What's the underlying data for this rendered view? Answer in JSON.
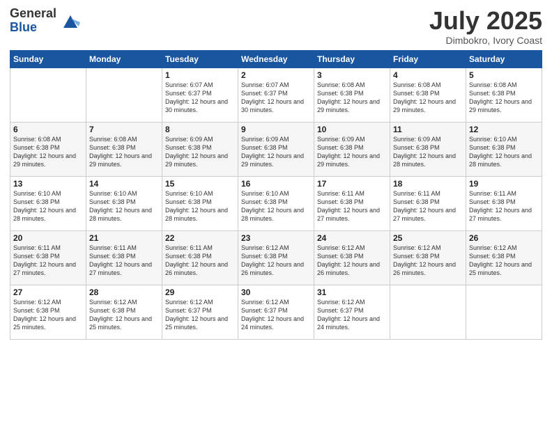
{
  "logo": {
    "general": "General",
    "blue": "Blue"
  },
  "header": {
    "month": "July 2025",
    "location": "Dimbokro, Ivory Coast"
  },
  "weekdays": [
    "Sunday",
    "Monday",
    "Tuesday",
    "Wednesday",
    "Thursday",
    "Friday",
    "Saturday"
  ],
  "weeks": [
    [
      {
        "day": "",
        "sunrise": "",
        "sunset": "",
        "daylight": ""
      },
      {
        "day": "",
        "sunrise": "",
        "sunset": "",
        "daylight": ""
      },
      {
        "day": "1",
        "sunrise": "Sunrise: 6:07 AM",
        "sunset": "Sunset: 6:37 PM",
        "daylight": "Daylight: 12 hours and 30 minutes."
      },
      {
        "day": "2",
        "sunrise": "Sunrise: 6:07 AM",
        "sunset": "Sunset: 6:37 PM",
        "daylight": "Daylight: 12 hours and 30 minutes."
      },
      {
        "day": "3",
        "sunrise": "Sunrise: 6:08 AM",
        "sunset": "Sunset: 6:38 PM",
        "daylight": "Daylight: 12 hours and 29 minutes."
      },
      {
        "day": "4",
        "sunrise": "Sunrise: 6:08 AM",
        "sunset": "Sunset: 6:38 PM",
        "daylight": "Daylight: 12 hours and 29 minutes."
      },
      {
        "day": "5",
        "sunrise": "Sunrise: 6:08 AM",
        "sunset": "Sunset: 6:38 PM",
        "daylight": "Daylight: 12 hours and 29 minutes."
      }
    ],
    [
      {
        "day": "6",
        "sunrise": "Sunrise: 6:08 AM",
        "sunset": "Sunset: 6:38 PM",
        "daylight": "Daylight: 12 hours and 29 minutes."
      },
      {
        "day": "7",
        "sunrise": "Sunrise: 6:08 AM",
        "sunset": "Sunset: 6:38 PM",
        "daylight": "Daylight: 12 hours and 29 minutes."
      },
      {
        "day": "8",
        "sunrise": "Sunrise: 6:09 AM",
        "sunset": "Sunset: 6:38 PM",
        "daylight": "Daylight: 12 hours and 29 minutes."
      },
      {
        "day": "9",
        "sunrise": "Sunrise: 6:09 AM",
        "sunset": "Sunset: 6:38 PM",
        "daylight": "Daylight: 12 hours and 29 minutes."
      },
      {
        "day": "10",
        "sunrise": "Sunrise: 6:09 AM",
        "sunset": "Sunset: 6:38 PM",
        "daylight": "Daylight: 12 hours and 29 minutes."
      },
      {
        "day": "11",
        "sunrise": "Sunrise: 6:09 AM",
        "sunset": "Sunset: 6:38 PM",
        "daylight": "Daylight: 12 hours and 28 minutes."
      },
      {
        "day": "12",
        "sunrise": "Sunrise: 6:10 AM",
        "sunset": "Sunset: 6:38 PM",
        "daylight": "Daylight: 12 hours and 28 minutes."
      }
    ],
    [
      {
        "day": "13",
        "sunrise": "Sunrise: 6:10 AM",
        "sunset": "Sunset: 6:38 PM",
        "daylight": "Daylight: 12 hours and 28 minutes."
      },
      {
        "day": "14",
        "sunrise": "Sunrise: 6:10 AM",
        "sunset": "Sunset: 6:38 PM",
        "daylight": "Daylight: 12 hours and 28 minutes."
      },
      {
        "day": "15",
        "sunrise": "Sunrise: 6:10 AM",
        "sunset": "Sunset: 6:38 PM",
        "daylight": "Daylight: 12 hours and 28 minutes."
      },
      {
        "day": "16",
        "sunrise": "Sunrise: 6:10 AM",
        "sunset": "Sunset: 6:38 PM",
        "daylight": "Daylight: 12 hours and 28 minutes."
      },
      {
        "day": "17",
        "sunrise": "Sunrise: 6:11 AM",
        "sunset": "Sunset: 6:38 PM",
        "daylight": "Daylight: 12 hours and 27 minutes."
      },
      {
        "day": "18",
        "sunrise": "Sunrise: 6:11 AM",
        "sunset": "Sunset: 6:38 PM",
        "daylight": "Daylight: 12 hours and 27 minutes."
      },
      {
        "day": "19",
        "sunrise": "Sunrise: 6:11 AM",
        "sunset": "Sunset: 6:38 PM",
        "daylight": "Daylight: 12 hours and 27 minutes."
      }
    ],
    [
      {
        "day": "20",
        "sunrise": "Sunrise: 6:11 AM",
        "sunset": "Sunset: 6:38 PM",
        "daylight": "Daylight: 12 hours and 27 minutes."
      },
      {
        "day": "21",
        "sunrise": "Sunrise: 6:11 AM",
        "sunset": "Sunset: 6:38 PM",
        "daylight": "Daylight: 12 hours and 27 minutes."
      },
      {
        "day": "22",
        "sunrise": "Sunrise: 6:11 AM",
        "sunset": "Sunset: 6:38 PM",
        "daylight": "Daylight: 12 hours and 26 minutes."
      },
      {
        "day": "23",
        "sunrise": "Sunrise: 6:12 AM",
        "sunset": "Sunset: 6:38 PM",
        "daylight": "Daylight: 12 hours and 26 minutes."
      },
      {
        "day": "24",
        "sunrise": "Sunrise: 6:12 AM",
        "sunset": "Sunset: 6:38 PM",
        "daylight": "Daylight: 12 hours and 26 minutes."
      },
      {
        "day": "25",
        "sunrise": "Sunrise: 6:12 AM",
        "sunset": "Sunset: 6:38 PM",
        "daylight": "Daylight: 12 hours and 26 minutes."
      },
      {
        "day": "26",
        "sunrise": "Sunrise: 6:12 AM",
        "sunset": "Sunset: 6:38 PM",
        "daylight": "Daylight: 12 hours and 25 minutes."
      }
    ],
    [
      {
        "day": "27",
        "sunrise": "Sunrise: 6:12 AM",
        "sunset": "Sunset: 6:38 PM",
        "daylight": "Daylight: 12 hours and 25 minutes."
      },
      {
        "day": "28",
        "sunrise": "Sunrise: 6:12 AM",
        "sunset": "Sunset: 6:38 PM",
        "daylight": "Daylight: 12 hours and 25 minutes."
      },
      {
        "day": "29",
        "sunrise": "Sunrise: 6:12 AM",
        "sunset": "Sunset: 6:37 PM",
        "daylight": "Daylight: 12 hours and 25 minutes."
      },
      {
        "day": "30",
        "sunrise": "Sunrise: 6:12 AM",
        "sunset": "Sunset: 6:37 PM",
        "daylight": "Daylight: 12 hours and 24 minutes."
      },
      {
        "day": "31",
        "sunrise": "Sunrise: 6:12 AM",
        "sunset": "Sunset: 6:37 PM",
        "daylight": "Daylight: 12 hours and 24 minutes."
      },
      {
        "day": "",
        "sunrise": "",
        "sunset": "",
        "daylight": ""
      },
      {
        "day": "",
        "sunrise": "",
        "sunset": "",
        "daylight": ""
      }
    ]
  ]
}
